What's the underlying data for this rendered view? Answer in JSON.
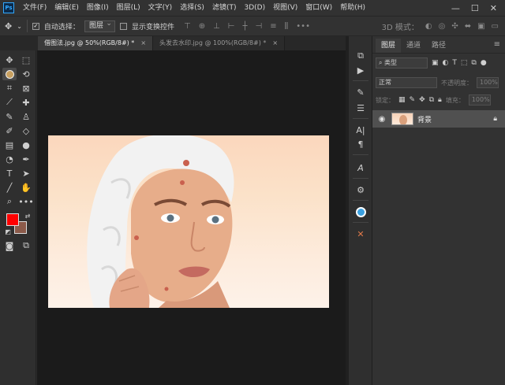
{
  "menubar": {
    "app_logo": "Ps",
    "items": [
      "文件(F)",
      "编辑(E)",
      "图像(I)",
      "图层(L)",
      "文字(Y)",
      "选择(S)",
      "滤镜(T)",
      "3D(D)",
      "视图(V)",
      "窗口(W)",
      "帮助(H)"
    ],
    "window_controls": [
      "—",
      "☐",
      "✕"
    ]
  },
  "options": {
    "auto_select_label": "自动选择：",
    "auto_select_checked": true,
    "auto_select_target": "图层",
    "show_transform_label": "显示变换控件",
    "show_transform_checked": false,
    "mode_3d_label": "3D 模式："
  },
  "tabs": [
    {
      "label": "借图法.jpg @ 50%(RGB/8#) *",
      "close": "×",
      "active": true
    },
    {
      "label": "头发去水印.jpg @ 100%(RGB/8#) *",
      "close": "×",
      "active": false
    }
  ],
  "colors": {
    "foreground": "#ff0000",
    "background": "#8b5a4a",
    "canvas_bg": "#1b1b1b"
  },
  "layers_panel": {
    "tabs": [
      "图层",
      "通道",
      "路径"
    ],
    "filter_label": "类型",
    "blend_mode": "正常",
    "opacity_label": "不透明度：",
    "opacity_value": "100%",
    "lock_label": "锁定：",
    "fill_label": "填充：",
    "fill_value": "100%",
    "layers": [
      {
        "name": "背景",
        "visible": true,
        "locked": true
      }
    ]
  }
}
